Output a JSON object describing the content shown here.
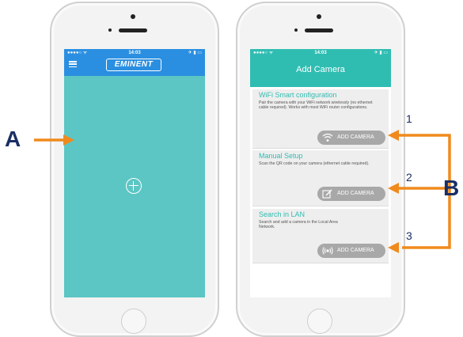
{
  "left_phone": {
    "status": {
      "left": "●●●●○ ᯤ",
      "time": "14:03",
      "right": "✈ ▮ ▭"
    },
    "logo_text": "EMINENT"
  },
  "right_phone": {
    "status": {
      "left": "●●●●○ ᯤ",
      "time": "14:03",
      "right": "✈ ▮ ▭"
    },
    "title": "Add Camera",
    "sections": [
      {
        "title": "WiFi Smart configuration",
        "description": "Pair the camera with your WiFi network wirelessly (no ethernet cable required). Works with most WiFi router configurations.",
        "button_label": "ADD CAMERA",
        "icon": "wifi-icon"
      },
      {
        "title": "Manual Setup",
        "description": "Scan the QR code on your camera (ethernet cable required).",
        "button_label": "ADD CAMERA",
        "icon": "edit-icon"
      },
      {
        "title": "Search in LAN",
        "description": "Search and add a camera in the Local Area Network.",
        "button_label": "ADD CAMERA",
        "icon": "broadcast-icon"
      }
    ]
  },
  "annotations": {
    "a": "A",
    "b": "B",
    "n1": "1",
    "n2": "2",
    "n3": "3",
    "arrow_color": "#f08a1c",
    "letter_color": "#1a2e64"
  }
}
